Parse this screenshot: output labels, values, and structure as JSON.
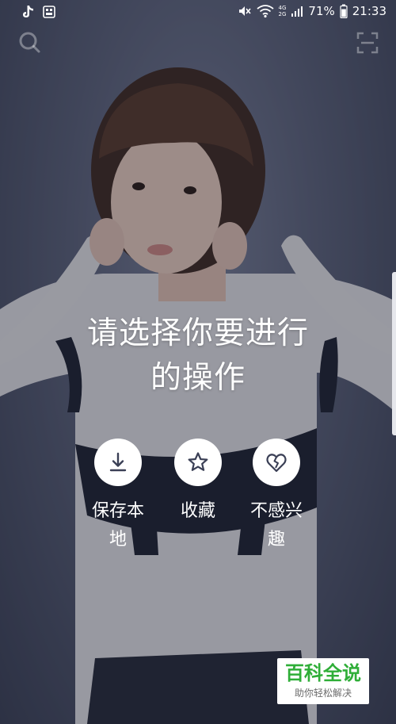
{
  "status_bar": {
    "battery": "71%",
    "time": "21:33",
    "network_upper": "4G",
    "network_lower": "2G"
  },
  "top_bar": {
    "left_icon": "search-icon",
    "right_icon": "scan-icon"
  },
  "prompt": {
    "line1": "请选择你要进行",
    "line2": "的操作"
  },
  "actions": [
    {
      "icon": "download-icon",
      "label_line1": "保存本",
      "label_line2": "地"
    },
    {
      "icon": "star-icon",
      "label_line1": "收藏",
      "label_line2": ""
    },
    {
      "icon": "broken-heart-icon",
      "label_line1": "不感兴",
      "label_line2": "趣"
    }
  ],
  "watermark": {
    "title": "百科全说",
    "subtitle": "助你轻松解决"
  },
  "colors": {
    "overlay": "#3c4258",
    "action_circle": "#ffffff",
    "watermark_green": "#2fae38"
  }
}
